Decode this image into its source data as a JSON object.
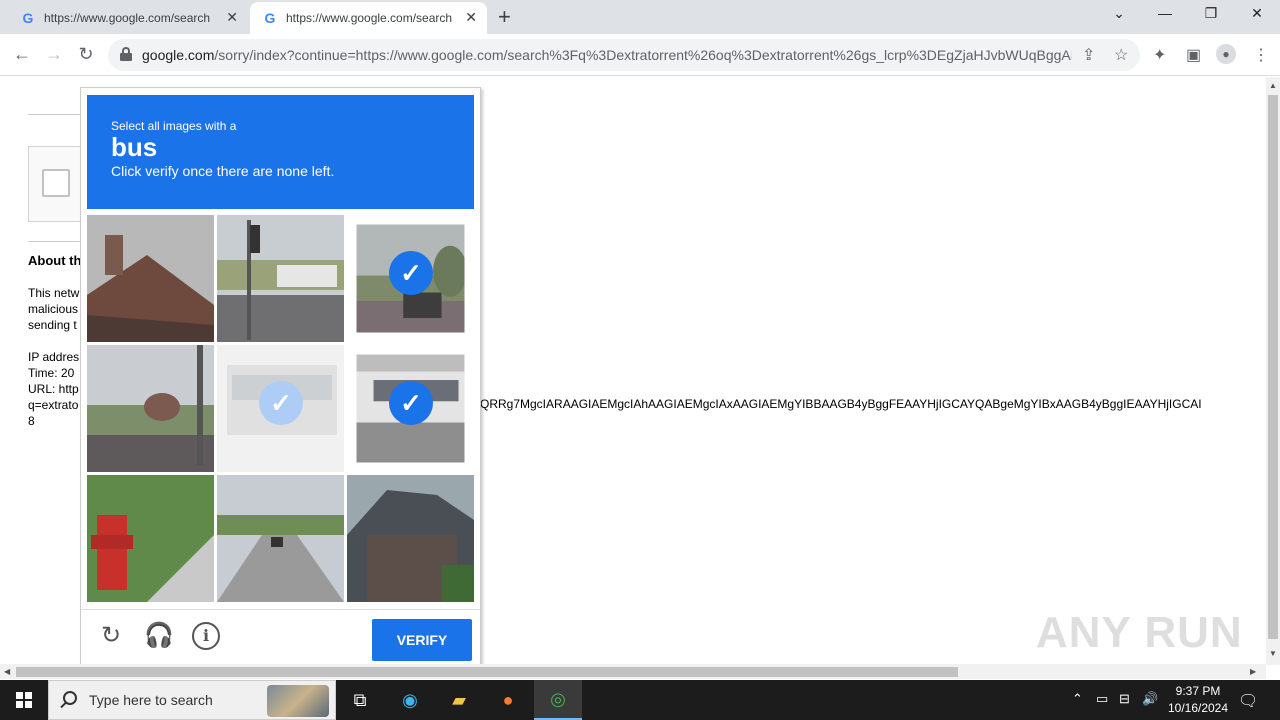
{
  "browser": {
    "tabs": [
      {
        "title": "https://www.google.com/search"
      },
      {
        "title": "https://www.google.com/search"
      }
    ],
    "new_tab": "+",
    "url_host": "google.com",
    "url_rest": "/sorry/index?continue=https://www.google.com/search%3Fq%3Dextratorrent%26oq%3Dextratorrent%26gs_lcrp%3DEgZjaHJvbWUqBggAE...",
    "controls": {
      "minimize": "—",
      "restore": "❐",
      "close": "✕",
      "tab_list": "⌄"
    }
  },
  "page": {
    "about_heading": "About th",
    "para_lines": [
      "This netw",
      "malicious",
      "sending t"
    ],
    "info_lines": [
      "IP addres",
      "Time: 20",
      "URL: http",
      "q=extrato",
      "8"
    ],
    "long_query": "QRRg7MgcIARAAGIAEMgcIAhAAGIAEMgcIAxAAGIAEMgYIBBAAGB4yBggFEAAYHjIGCAYQABgeMgYIBxAAGB4yBggIEAAYHjIGCAI"
  },
  "captcha": {
    "prompt_sub": "Select all images with a",
    "prompt_word": "bus",
    "prompt_instruction": "Click verify once there are none left.",
    "verify_label": "VERIFY",
    "tiles": [
      {
        "subject": "roof",
        "state": "normal"
      },
      {
        "subject": "traffic-light-street",
        "state": "normal"
      },
      {
        "subject": "bus-street",
        "state": "selected"
      },
      {
        "subject": "street-trees",
        "state": "normal"
      },
      {
        "subject": "bus",
        "state": "faded-selected"
      },
      {
        "subject": "bus-window",
        "state": "selected"
      },
      {
        "subject": "fire-hydrant",
        "state": "normal"
      },
      {
        "subject": "road-car",
        "state": "normal"
      },
      {
        "subject": "house",
        "state": "normal"
      }
    ]
  },
  "watermark": "ANY RUN",
  "taskbar": {
    "search_placeholder": "Type here to search",
    "time": "9:37 PM",
    "date": "10/16/2024"
  }
}
